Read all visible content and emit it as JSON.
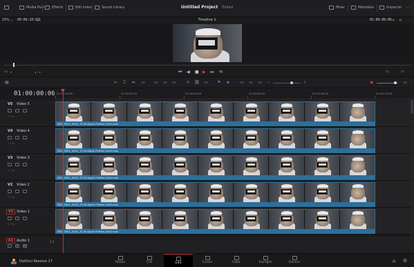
{
  "topbar": {
    "media_pool": "Media Pool",
    "effects": "Effects",
    "edit_index": "Edit Index",
    "sound_library": "Sound Library",
    "project_title": "Untitled Project",
    "project_status": "Edited",
    "mixer": "Mixer",
    "metadata": "Metadata",
    "inspector": "Inspector"
  },
  "viewer": {
    "zoom": "15%",
    "source_timecode": "00:00:10:01",
    "clip_count": "1",
    "timeline_name": "Timeline 1",
    "record_timecode": "01:00:06:06"
  },
  "timeline": {
    "current_timecode": "01:00:00:06",
    "ruler_labels": [
      "01:00:00:00",
      "01:00:02:00",
      "01:00:04:00",
      "01:00:06:00",
      "01:00:08:00",
      "01:00:10:00"
    ],
    "tracks": [
      {
        "id": "V5",
        "name": "Video 5",
        "clip": "IMG_0001_0001_TC16-Apple ProRes 4444.mov"
      },
      {
        "id": "V4",
        "name": "Video 4",
        "clip": "IMG_0001_0001_TC16-Apple ProRes 4444.mov"
      },
      {
        "id": "V3",
        "name": "Video 3",
        "clip": "IMG_0001_0001_TC16-Apple ProRes 4444.mov"
      },
      {
        "id": "V2",
        "name": "Video 2",
        "clip": "IMG_0001_0001_TC16-Apple ProRes 4444.mov"
      },
      {
        "id": "V1",
        "name": "Video 1",
        "clip": "IMG_0001_0001_TC16-Apple ProRes 4444.mov"
      }
    ],
    "clip_sub": "1 Clip",
    "audio": {
      "id": "A1",
      "name": "Audio 1",
      "channels": "2.0"
    }
  },
  "pages": [
    "Media",
    "Cut",
    "Edit",
    "Fusion",
    "Color",
    "Fairlight",
    "Deliver"
  ],
  "active_page": "Edit",
  "app": {
    "name": "DaVinci Resolve 17"
  },
  "colors": {
    "accent": "#d43a3a",
    "clip_blue": "#2d6f9c",
    "playhead": "#d02a2a"
  }
}
